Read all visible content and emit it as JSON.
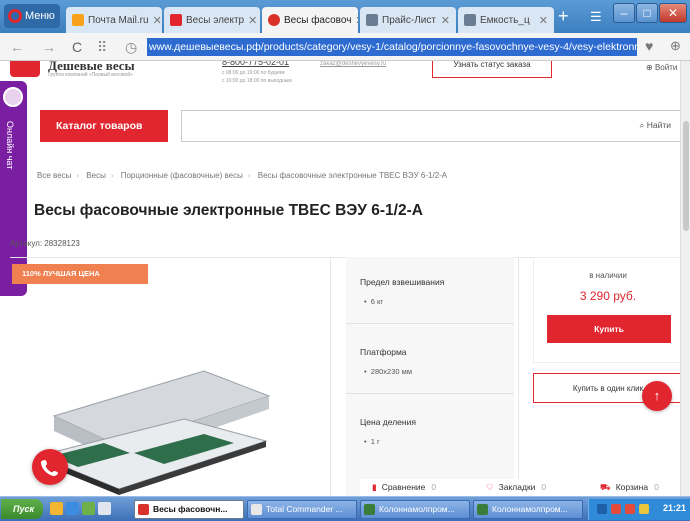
{
  "browser": {
    "menu_label": "Меню",
    "tabs": [
      {
        "label": "Почта Mail.ru",
        "favicon_color": "#f7a21b"
      },
      {
        "label": "Весы электр",
        "favicon_color": "#e2262f"
      },
      {
        "label": "Весы фасовоч",
        "favicon_color": "#d9322b"
      },
      {
        "label": "Прайс-Лист",
        "favicon_color": "#6b7d93"
      },
      {
        "label": "Емкость_ц",
        "favicon_color": "#6b7d93"
      }
    ],
    "url": "www.дешевыевесы.рф/products/category/vesy-1/catalog/porcionnye-fasovochnye-vesy-4/vesy-elektronnye-"
  },
  "header": {
    "logo_title": "Дешевые весы",
    "logo_sub": "Группа компаний «Первый весовой»",
    "phone": "8-800-775-02-01",
    "hours": [
      "с 08:00 до 19:00 по будням",
      "с 10:00 до 18:00 по выходным"
    ],
    "email": "zakaz@deshevyevesy.ru",
    "order_status": "Узнать статус заказа",
    "login": "Войти"
  },
  "chat": {
    "label": "Онлайн чат"
  },
  "catalog_button": "Каталог товаров",
  "search": {
    "button": "Найти",
    "placeholder": ""
  },
  "breadcrumb": [
    "Все весы",
    "Весы",
    "Порционные (фасовочные) весы",
    "Весы фасовочные электронные ТВЕС ВЭУ 6-1/2-А"
  ],
  "product": {
    "title": "Весы фасовочные электронные ТВЕС ВЭУ 6-1/2-А",
    "sku_label": "Артикул:",
    "sku": "28328123",
    "badge": "110% ЛУЧШАЯ ЦЕНА",
    "specs": [
      {
        "label": "Предел взвешивания",
        "value": "6 кг"
      },
      {
        "label": "Платформа",
        "value": "280х230 мм"
      },
      {
        "label": "Цена деления",
        "value": "1 г"
      }
    ],
    "stock": "в наличии",
    "price": "3 290 руб.",
    "buy": "Купить",
    "oneclick": "Купить в один клик"
  },
  "footer_bar": [
    {
      "label": "Сравнение",
      "count": "0"
    },
    {
      "label": "Закладки",
      "count": "0"
    },
    {
      "label": "Корзина",
      "count": "0"
    }
  ],
  "taskbar": {
    "start": "Пуск",
    "tasks": [
      {
        "label": "Весы фасовочн...",
        "active": true,
        "icon_color": "#d9322b"
      },
      {
        "label": "Total Commander ...",
        "active": false,
        "icon_color": "#e8e8e8"
      },
      {
        "label": "Колоннамолпром...",
        "active": false,
        "icon_color": "#3a7d3a"
      },
      {
        "label": "Колоннамолпром...",
        "active": false,
        "icon_color": "#3a7d3a"
      }
    ],
    "clock": "21:21"
  },
  "colors": {
    "accent": "#e2262f",
    "chat": "#7b1fa2",
    "badge": "#f08050"
  }
}
